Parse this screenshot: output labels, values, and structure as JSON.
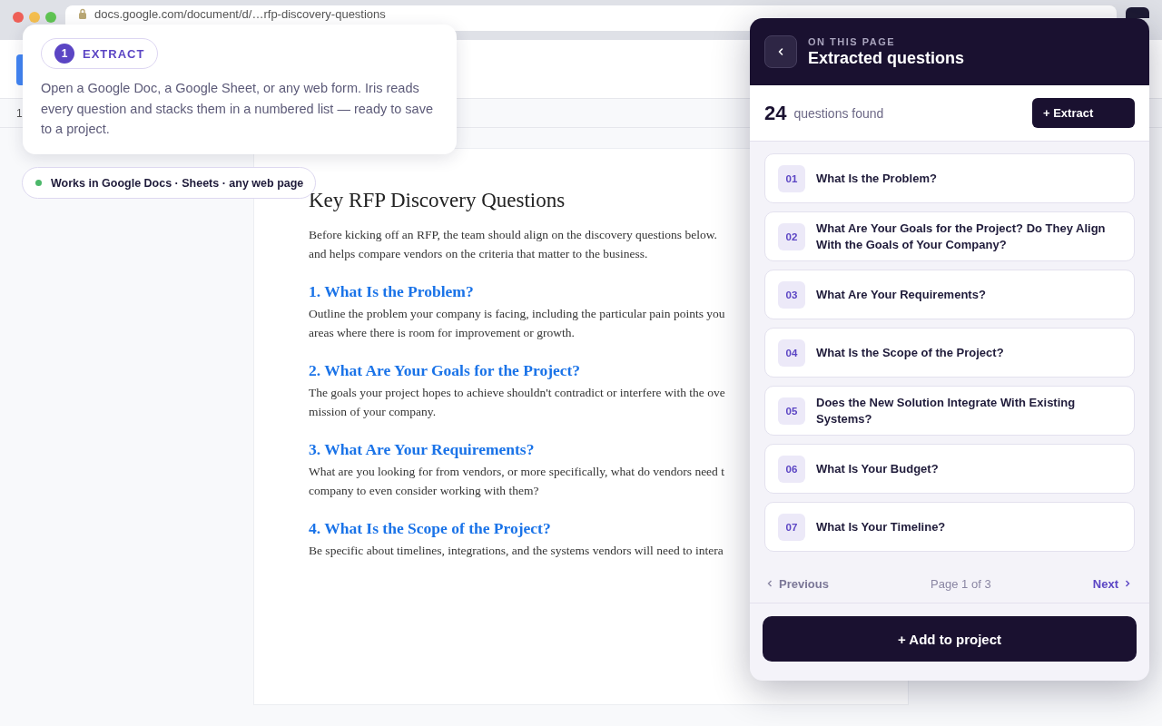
{
  "browser": {
    "url": "docs.google.com/document/d/…rfp-discovery-questions",
    "ruler_mark": "1"
  },
  "callout": {
    "step": "1",
    "label": "EXTRACT",
    "text": "Open a Google Doc, a Google Sheet, or any web form. Iris reads every question and stacks them in a numbered list — ready to save to a project."
  },
  "compat_pill": {
    "text": "Works in Google Docs · Sheets · any web page",
    "color": "#4cb86a"
  },
  "document": {
    "title": "Key RFP Discovery Questions",
    "intro": [
      "Before kicking off an RFP, the team should align on the discovery questions below.",
      "and helps compare vendors on the criteria that matter to the business."
    ],
    "sections": [
      {
        "heading": "1. What Is the Problem?",
        "lines": [
          "Outline the problem your company is facing, including the particular pain points you",
          "areas where there is room for improvement or growth."
        ]
      },
      {
        "heading": "2. What Are Your Goals for the Project?",
        "lines": [
          "The goals your project hopes to achieve shouldn't contradict or interfere with the ove",
          "mission of your company."
        ]
      },
      {
        "heading": "3. What Are Your Requirements?",
        "lines": [
          "What are you looking for from vendors, or more specifically, what do vendors need t",
          "company to even consider working with them?"
        ]
      },
      {
        "heading": "4. What Is the Scope of the Project?",
        "lines": [
          "Be specific about timelines, integrations, and the systems vendors will need to intera"
        ]
      }
    ]
  },
  "panel": {
    "eyebrow": "ON THIS PAGE",
    "title": "Extracted questions",
    "count": "24",
    "count_label": "questions found",
    "extract_button": "+ Extract",
    "questions": [
      {
        "number": "01",
        "text": "What Is the Problem?"
      },
      {
        "number": "02",
        "text": "What Are Your Goals for the Project? Do They Align With the Goals of Your Company?"
      },
      {
        "number": "03",
        "text": "What Are Your Requirements?"
      },
      {
        "number": "04",
        "text": "What Is the Scope of the Project?"
      },
      {
        "number": "05",
        "text": "Does the New Solution Integrate With Existing Systems?"
      },
      {
        "number": "06",
        "text": "What Is Your Budget?"
      },
      {
        "number": "07",
        "text": "What Is Your Timeline?"
      }
    ],
    "pagination": {
      "previous": "Previous",
      "page": "Page 1 of 3",
      "next": "Next"
    },
    "add_button": "+ Add to project"
  }
}
